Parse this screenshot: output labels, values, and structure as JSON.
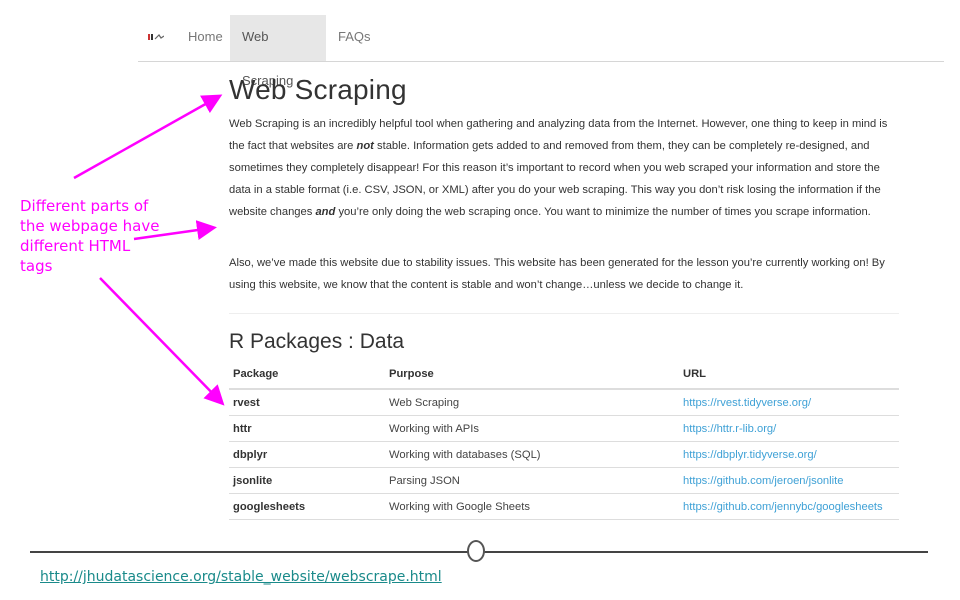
{
  "nav": {
    "brand_icon": "site-logo-icon",
    "items": [
      {
        "label": "Home",
        "active": false
      },
      {
        "label": "Web Scraping",
        "active": true
      },
      {
        "label": "FAQs",
        "active": false
      }
    ]
  },
  "page": {
    "title": "Web Scraping",
    "paragraph1": {
      "part1": "Web Scraping is an incredibly helpful tool when gathering and analyzing data from the Internet. However, one thing to keep in mind is the fact that websites are ",
      "emphasis1": "not",
      "part2": " stable. Information gets added to and removed from them, they can be completely re-designed, and sometimes they completely disappear! For this reason it’s important to record when you web scraped your information and store the data in a stable format (i.e. CSV, JSON, or XML) after you do your web scraping. This way you don’t risk losing the information if the website changes ",
      "emphasis2": "and",
      "part3": " you’re only doing the web scraping once. You want to minimize the number of times you scrape information."
    },
    "paragraph2": "Also, we’ve made this website due to stability issues. This website has been generated for the lesson you’re currently working on! By using this website, we know that the content is stable and won’t change…unless we decide to change it.",
    "section_title": "R Packages : Data",
    "table": {
      "headers": [
        "Package",
        "Purpose",
        "URL"
      ],
      "rows": [
        {
          "package": "rvest",
          "purpose": "Web Scraping",
          "url": "https://rvest.tidyverse.org/"
        },
        {
          "package": "httr",
          "purpose": "Working with APIs",
          "url": "https://httr.r-lib.org/"
        },
        {
          "package": "dbplyr",
          "purpose": "Working with databases (SQL)",
          "url": "https://dbplyr.tidyverse.org/"
        },
        {
          "package": "jsonlite",
          "purpose": "Parsing JSON",
          "url": "https://github.com/jeroen/jsonlite"
        },
        {
          "package": "googlesheets",
          "purpose": "Working with Google Sheets",
          "url": "https://github.com/jennybc/googlesheets"
        }
      ]
    }
  },
  "annotation": {
    "text": "Different parts of the webpage have different HTML tags",
    "color": "#ff00ff"
  },
  "footer": {
    "link": "http://jhudatascience.org/stable_website/webscrape.html"
  }
}
